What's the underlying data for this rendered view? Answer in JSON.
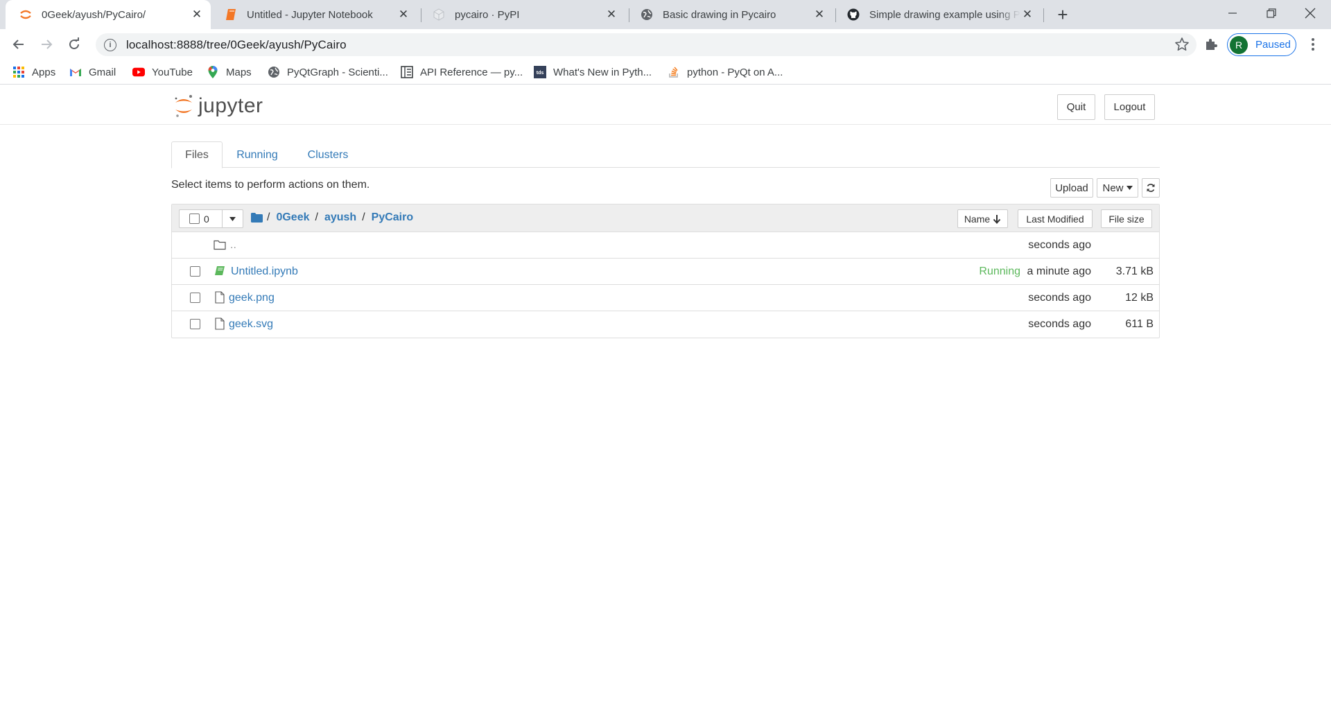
{
  "browser": {
    "tabs": [
      {
        "title": "0Geek/ayush/PyCairo/",
        "favicon": "jupyter-icon",
        "active": true
      },
      {
        "title": "Untitled - Jupyter Notebook",
        "favicon": "notebook-icon",
        "active": false
      },
      {
        "title": "pycairo · PyPI",
        "favicon": "pypi-icon",
        "active": false
      },
      {
        "title": "Basic drawing in Pycairo",
        "favicon": "globe-icon",
        "active": false
      },
      {
        "title": "Simple drawing example using Py",
        "favicon": "github-icon",
        "active": false
      }
    ],
    "url": "localhost:8888/tree/0Geek/ayush/PyCairo",
    "profile": {
      "initial": "R",
      "label": "Paused"
    },
    "bookmarks": [
      {
        "label": "Apps",
        "icon": "apps-grid-icon"
      },
      {
        "label": "Gmail",
        "icon": "gmail-icon"
      },
      {
        "label": "YouTube",
        "icon": "youtube-icon"
      },
      {
        "label": "Maps",
        "icon": "maps-pin-icon"
      },
      {
        "label": "PyQtGraph - Scienti...",
        "icon": "globe-icon"
      },
      {
        "label": "API Reference — py...",
        "icon": "book-icon"
      },
      {
        "label": "What's New in Pyth...",
        "icon": "tds-icon"
      },
      {
        "label": "python - PyQt on A...",
        "icon": "stackoverflow-icon"
      }
    ]
  },
  "jupyter": {
    "logo_text": "jupyter",
    "header_buttons": {
      "quit": "Quit",
      "logout": "Logout"
    },
    "tabs": [
      {
        "label": "Files",
        "active": true
      },
      {
        "label": "Running",
        "active": false
      },
      {
        "label": "Clusters",
        "active": false
      }
    ],
    "hint": "Select items to perform actions on them.",
    "actions": {
      "upload": "Upload",
      "new": "New"
    },
    "selected_count": "0",
    "breadcrumb": [
      "0Geek",
      "ayush",
      "PyCairo"
    ],
    "sort": {
      "name": "Name",
      "last_modified": "Last Modified",
      "file_size": "File size"
    },
    "files": [
      {
        "name": "..",
        "type": "folder",
        "status": "",
        "modified": "seconds ago",
        "size": ""
      },
      {
        "name": "Untitled.ipynb",
        "type": "notebook",
        "status": "Running",
        "modified": "a minute ago",
        "size": "3.71 kB"
      },
      {
        "name": "geek.png",
        "type": "file",
        "status": "",
        "modified": "seconds ago",
        "size": "12 kB"
      },
      {
        "name": "geek.svg",
        "type": "file",
        "status": "",
        "modified": "seconds ago",
        "size": "611 B"
      }
    ]
  },
  "colors": {
    "link": "#337ab7",
    "running": "#5cb85c",
    "jupyter_orange": "#f37726",
    "chrome_blue": "#1a73e8"
  }
}
